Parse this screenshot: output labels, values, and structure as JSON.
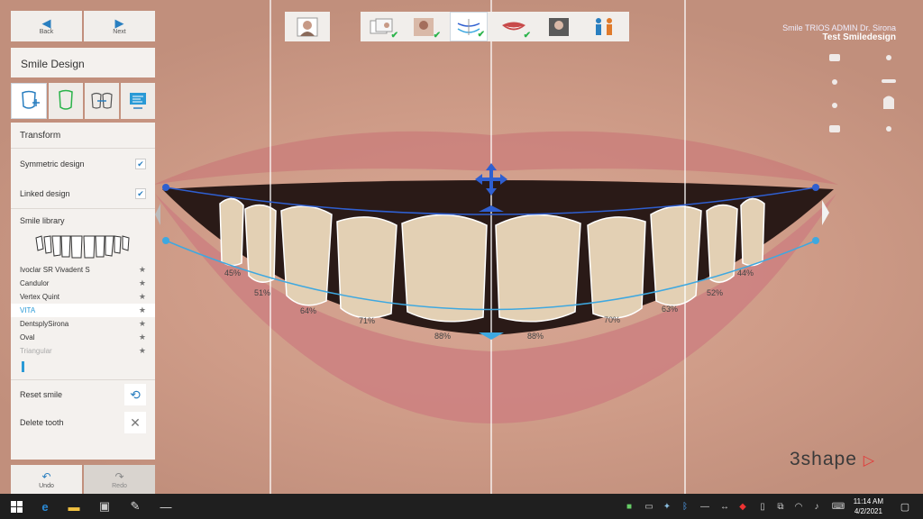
{
  "nav": {
    "back": "Back",
    "next": "Next",
    "undo": "Undo",
    "redo": "Redo"
  },
  "panel": {
    "title": "Smile Design",
    "section": "Transform",
    "symmetric": "Symmetric design",
    "linked": "Linked design",
    "library_label": "Smile library",
    "library": [
      {
        "name": "Ivoclar SR Vivadent S",
        "state": "normal"
      },
      {
        "name": "Candulor",
        "state": "normal"
      },
      {
        "name": "Vertex Quint",
        "state": "normal"
      },
      {
        "name": "VITA",
        "state": "selected"
      },
      {
        "name": "DentsplySirona",
        "state": "normal"
      },
      {
        "name": "Oval",
        "state": "normal"
      },
      {
        "name": "Triangular",
        "state": "faded"
      }
    ],
    "reset": "Reset smile",
    "delete": "Delete tooth"
  },
  "header": {
    "line1": "Smile TRIOS ADMIN Dr. Sirona",
    "line2": "Test Smiledesign"
  },
  "logo": {
    "text": "3shape",
    "mark": "▷"
  },
  "percent": [
    {
      "id": "l45",
      "label": "45%"
    },
    {
      "id": "l51",
      "label": "51%"
    },
    {
      "id": "l64",
      "label": "64%"
    },
    {
      "id": "l71",
      "label": "71%"
    },
    {
      "id": "l88",
      "label": "88%"
    },
    {
      "id": "r88",
      "label": "88%"
    },
    {
      "id": "r70",
      "label": "70%"
    },
    {
      "id": "r63",
      "label": "63%"
    },
    {
      "id": "r52",
      "label": "52%"
    },
    {
      "id": "r44",
      "label": "44%"
    }
  ],
  "taskbar": {
    "time": "11:14 AM",
    "date": "4/2/2021"
  },
  "colors": {
    "accent": "#2a7fc0",
    "check": "#2bb34a",
    "curve_top": "#2f5fd0",
    "curve_bottom": "#3ea8e0"
  }
}
